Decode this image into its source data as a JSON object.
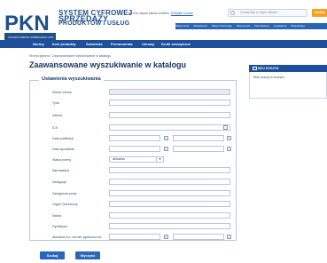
{
  "header": {
    "logo_lines": [
      "SYSTEM CYFROWEJ",
      "SPRZEDAŻY",
      "PRODUKTÓW I USŁUG"
    ],
    "org_small": "POLSKI KOMITET NORMALIZACYJNY",
    "info_text": "Strona używa plików cookies.",
    "info_link": "Polityka Cookie",
    "search_placeholder": "Szukaj listy w całym sklepie...",
    "search_button": "Szukaj"
  },
  "top_links": [
    "Sklep teraz",
    "Aktualności",
    "Sklep Informacje",
    "Mój koszyk",
    "Zamówienia",
    "Logowanie",
    "Rejestracja"
  ],
  "nav": [
    "Normy",
    "Inne produkty",
    "Szkolenia",
    "Prenumerata",
    "Umowy",
    "Druki zewnętrzne"
  ],
  "breadcrumb": "Strona główna / Zaawansowane wyszukiwanie w katalogu",
  "page_title": "Zaawansowane wyszukiwanie w katalogu",
  "form": {
    "legend": "Ustawienia wyszukiwania",
    "fields": [
      {
        "label": "Numer normy"
      },
      {
        "label": "Tytuł"
      },
      {
        "label": "Zakres"
      },
      {
        "label": "ICS"
      },
      {
        "label": "Data publikacji"
      },
      {
        "label": "Data wycofania"
      },
      {
        "label": "Status normy",
        "value": "aktualna"
      },
      {
        "label": "Wprowadza"
      },
      {
        "label": "Zastępuje"
      },
      {
        "label": "Zastąpiona przez"
      },
      {
        "label": "Organ Techniczny"
      },
      {
        "label": "Sektor"
      },
      {
        "label": "Dyrektywa"
      },
      {
        "label": "Aktualna w.o. normie zgodności do"
      }
    ]
  },
  "buttons": {
    "search": "Szukaj",
    "clear": "Wyczyść"
  },
  "right_panel": {
    "title": "MÓJ KOSZYK",
    "text": "Brak pozycji w koszyku."
  }
}
